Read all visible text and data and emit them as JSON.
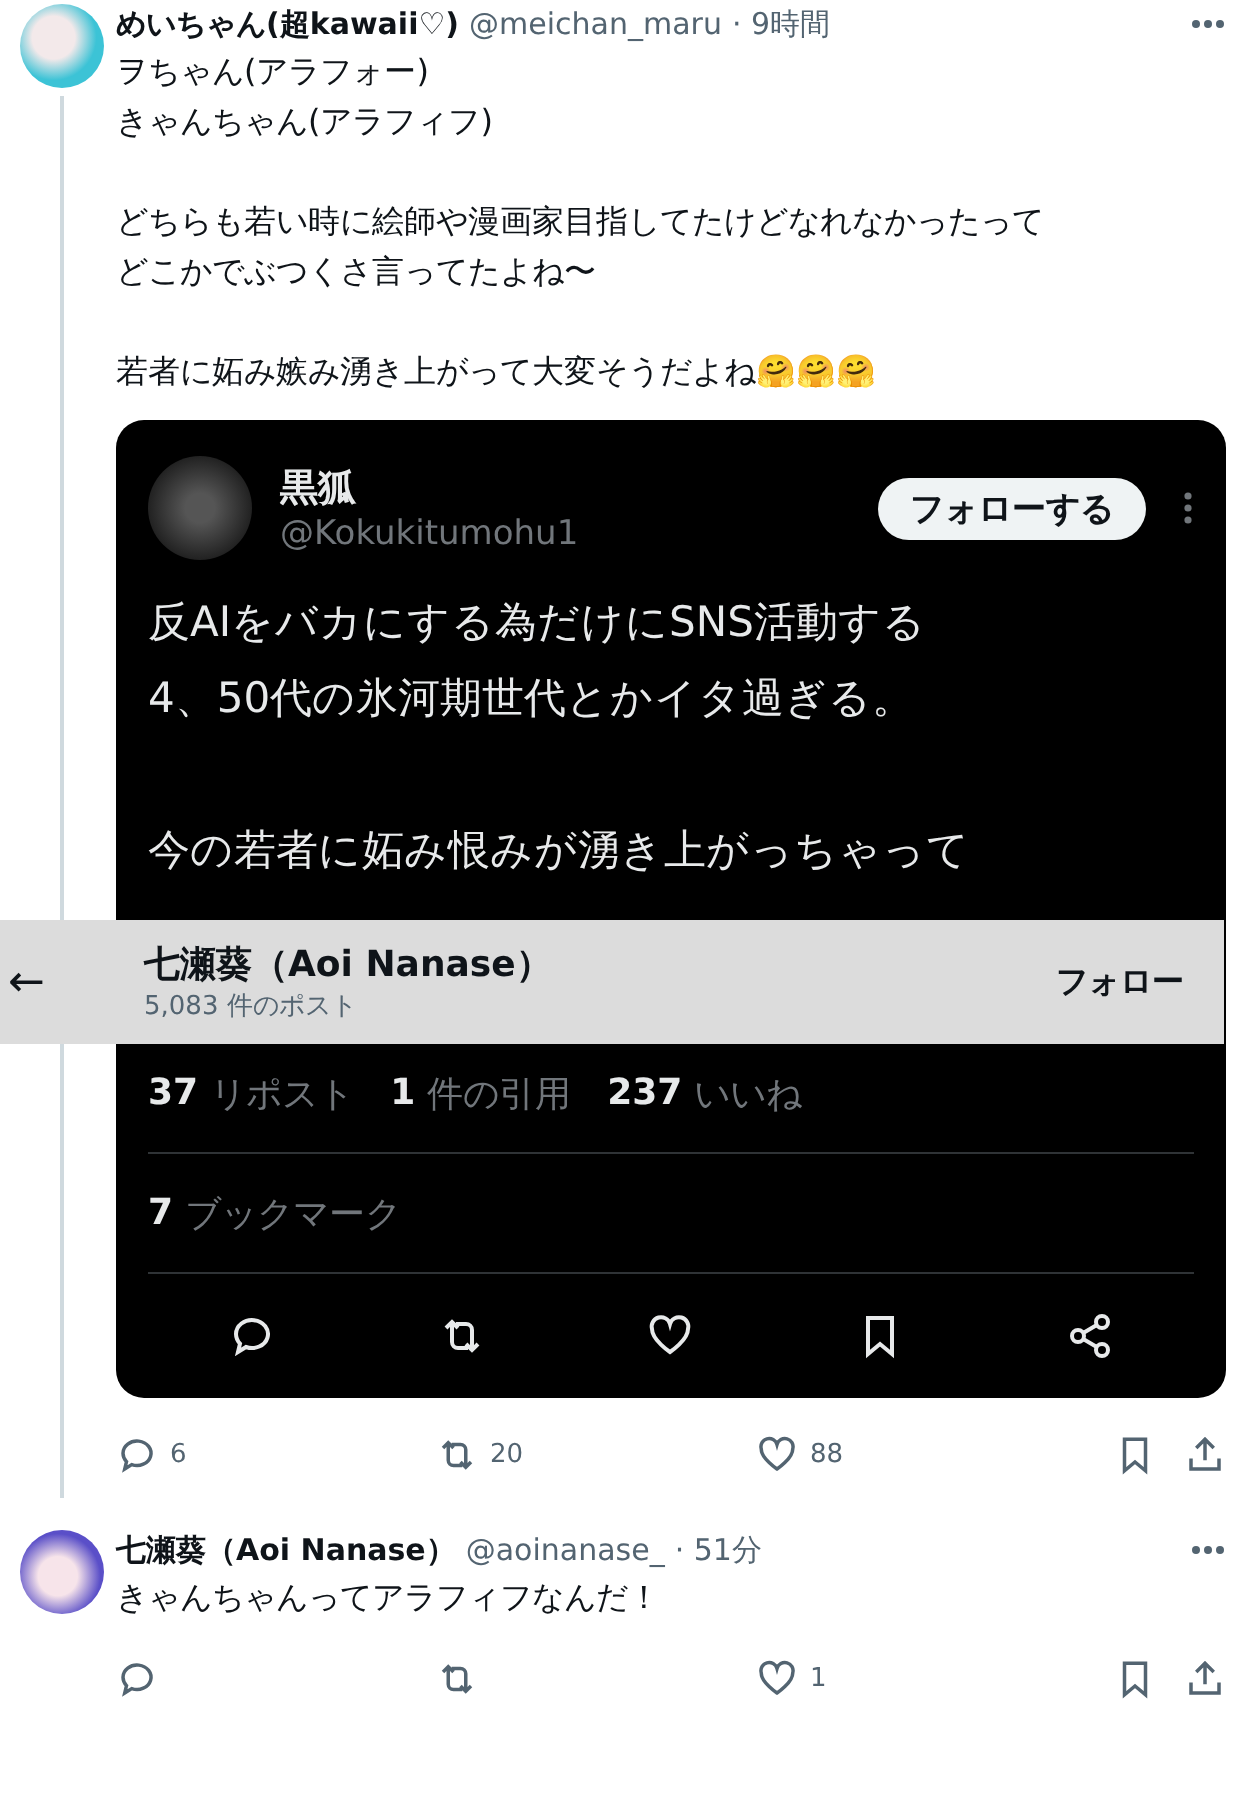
{
  "main_post": {
    "name": "めいちゃん(超kawaii♡)",
    "handle": "@meichan_maru",
    "time": "· 9時間",
    "paragraphs": [
      [
        "ヲちゃん(アラフォー)",
        "きゃんちゃん(アラフィフ)"
      ],
      [
        "どちらも若い時に絵師や漫画家目指してたけどなれなかったって",
        "どこかでぶつくさ言ってたよね〜"
      ],
      [
        "若者に妬み嫉み湧き上がって大変そうだよね🤗🤗🤗"
      ]
    ],
    "embedded_screenshot": {
      "name": "黒狐",
      "handle": "@Kokukitumohu1",
      "follow_button": "フォローする",
      "paragraphs": [
        [
          "反AIをバカにする為だけにSNS活動する",
          "4、50代の氷河期世代とかイタ過ぎる。"
        ],
        [
          "今の若者に妬み恨みが湧き上がっちゃって"
        ]
      ],
      "stats": [
        {
          "count": "37",
          "label": "リポスト"
        },
        {
          "count": "1",
          "label": "件の引用"
        },
        {
          "count": "237",
          "label": "いいね"
        }
      ],
      "bookmarks": {
        "count": "7",
        "label": "ブックマーク"
      }
    },
    "actions": [
      {
        "kind": "reply",
        "count": "6"
      },
      {
        "kind": "repost",
        "count": "20"
      },
      {
        "kind": "like",
        "count": "88"
      },
      {
        "kind": "bookmark"
      },
      {
        "kind": "share"
      }
    ]
  },
  "profile_header": {
    "back": "←",
    "name": "七瀬葵（Aoi Nanase）",
    "posts": "5,083 件のポスト",
    "follow_button": "フォロー"
  },
  "reply_post": {
    "name": "七瀬葵（Aoi Nanase）",
    "handle": "@aoinanase_",
    "time": "· 51分",
    "lines": [
      "きゃんちゃんってアラフィフなんだ！"
    ],
    "actions": [
      {
        "kind": "reply"
      },
      {
        "kind": "repost"
      },
      {
        "kind": "like",
        "count": "1"
      },
      {
        "kind": "bookmark"
      },
      {
        "kind": "share"
      }
    ]
  }
}
